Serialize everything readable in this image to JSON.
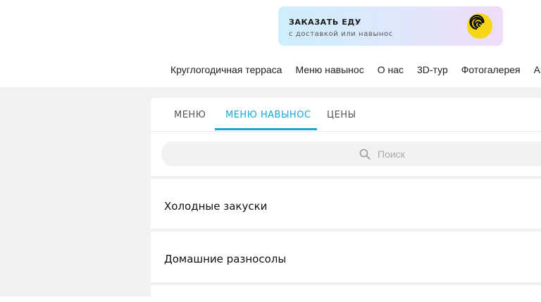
{
  "order": {
    "title": "ЗАКАЗАТЬ ЕДУ",
    "subtitle": "с доставкой или навынос",
    "logo_icon": "spiral-icon",
    "logo_color": "#f6d715"
  },
  "topnav": {
    "items": [
      {
        "label": "Круглогодичная терраса"
      },
      {
        "label": "Меню навынос"
      },
      {
        "label": "О нас"
      },
      {
        "label": "3D-тур"
      },
      {
        "label": "Фотогалерея"
      },
      {
        "label": "Ак"
      }
    ]
  },
  "tabs": [
    {
      "label": "МЕНЮ",
      "active": false
    },
    {
      "label": "МЕНЮ НАВЫНОС",
      "active": true
    },
    {
      "label": "ЦЕНЫ",
      "active": false
    }
  ],
  "accent_color": "#1aa6d9",
  "search": {
    "placeholder": "Поиск",
    "icon": "search-icon"
  },
  "categories": [
    {
      "label": "Холодные закуски"
    },
    {
      "label": "Домашние разносолы"
    }
  ]
}
